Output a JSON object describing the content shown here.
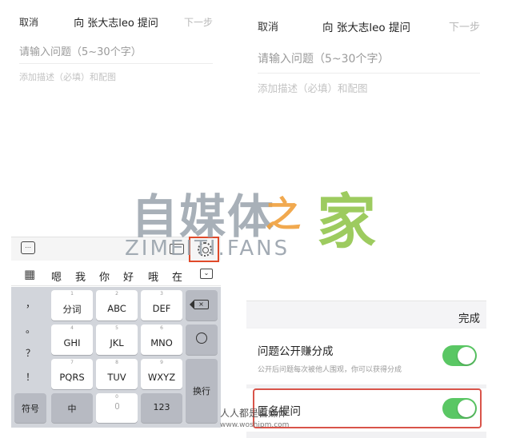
{
  "left": {
    "header": {
      "cancel": "取消",
      "title": "向 张大志leo 提问",
      "next": "下一步"
    },
    "question_placeholder": "请输入问题（5~30个字）",
    "description_placeholder": "添加描述（必填）和配图",
    "candidates": [
      "嗯",
      "我",
      "你",
      "好",
      "哦",
      "在"
    ],
    "keys": {
      "comma": "，",
      "period": "。",
      "question": "？",
      "exclaim": "！",
      "k1_num": "1",
      "k1": "分词",
      "k2_num": "2",
      "k2": "ABC",
      "k3_num": "3",
      "k3": "DEF",
      "k4_num": "4",
      "k4": "GHI",
      "k5_num": "5",
      "k5": "JKL",
      "k6_num": "6",
      "k6": "MNO",
      "k7_num": "7",
      "k7": "PQRS",
      "k8_num": "8",
      "k8": "TUV",
      "k9_num": "9",
      "k9": "WXYZ",
      "k0_num": "0",
      "symbols": "符号",
      "chinese": "中",
      "numbers": "123",
      "enter": "换行"
    }
  },
  "right": {
    "header": {
      "cancel": "取消",
      "title": "向 张大志leo 提问",
      "next": "下一步"
    },
    "question_placeholder": "请输入问题（5~30个字）",
    "description_placeholder": "添加描述（必填）和配图",
    "done": "完成",
    "options": [
      {
        "title": "问题公开赚分成",
        "subtitle": "公开后问题每次被他人围观，你可以获得分成",
        "enabled": true
      },
      {
        "title": "匿名提问",
        "enabled": true
      }
    ]
  },
  "watermark": {
    "brand_cn_main": "自媒体",
    "brand_cn_zhi": "之",
    "brand_cn_jia": "家",
    "brand_en": "ZIMEITI.FANS",
    "footer_cn": "人人都是自媒体",
    "footer_url": "www.woshipm.com"
  },
  "colors": {
    "toggle_on": "#5ac764",
    "highlight": "#d9544a",
    "keyboard_bg": "#d2d5db"
  }
}
